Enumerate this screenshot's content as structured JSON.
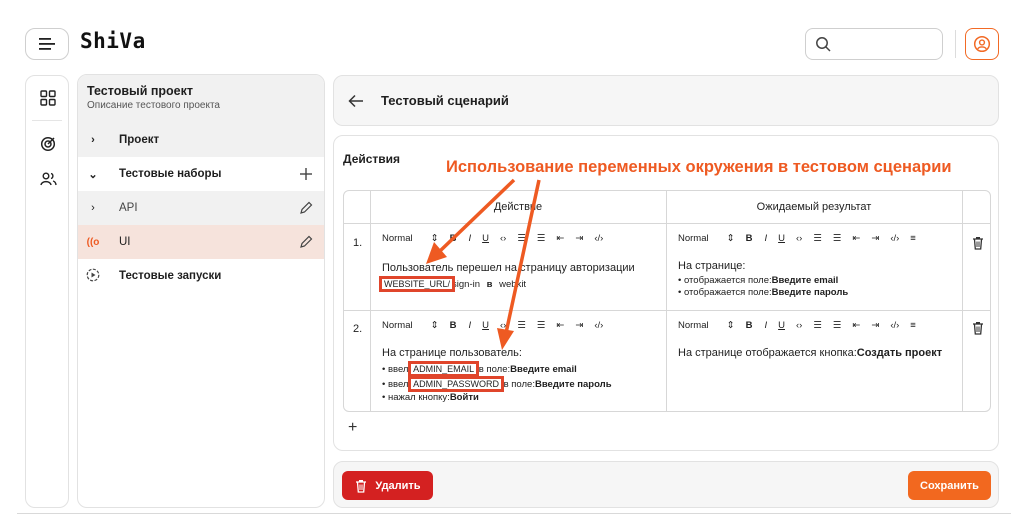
{
  "app": {
    "logo": "ShiVa"
  },
  "header": {
    "search_placeholder": ""
  },
  "project": {
    "title": "Тестовый проект",
    "description": "Описание тестового проекта"
  },
  "tree": {
    "items": [
      {
        "label": "Проект",
        "chevron": "›"
      },
      {
        "label": "Тестовые наборы",
        "chevron": "⌄"
      },
      {
        "label": "API",
        "chevron": "›"
      },
      {
        "label": "UI",
        "chevron": "((o"
      },
      {
        "label": "Тестовые запуски"
      }
    ]
  },
  "scenario": {
    "title": "Тестовый сценарий"
  },
  "actions": {
    "title": "Действия",
    "annotation": "Использование переменных окружения в тестовом сценарии",
    "columns": {
      "action": "Действие",
      "expected": "Ожидаемый результат"
    },
    "toolbar": {
      "format": "Normal",
      "bold": "B",
      "italic": "I",
      "underline": "U",
      "code": "‹›",
      "ol": "☰",
      "ul": "☰",
      "outdent": "⇤",
      "indent": "⇥",
      "codeblock": "‹/›",
      "strike": "≡"
    },
    "steps": [
      {
        "number": "1.",
        "action_line1": "Пользователь перешел на страницу авторизации",
        "action_var": "WEBSITE_URL/",
        "action_rest": "sign-in",
        "action_in": "в",
        "action_tail": "webkit",
        "expected_title": "На странице:",
        "expected_b1_prefix": "• отображается поле:",
        "expected_b1_bold": "Введите email",
        "expected_b2_prefix": "• отображается поле:",
        "expected_b2_bold": "Введите пароль"
      },
      {
        "number": "2.",
        "action_line1": "На странице пользователь:",
        "b1_prefix": "• ввел",
        "b1_var": "ADMIN_EMAIL",
        "b1_mid": "в поле:",
        "b1_bold": "Введите email",
        "b2_prefix": "• ввел",
        "b2_var": "ADMIN_PASSWORD",
        "b2_mid": "в поле:",
        "b2_bold": "Введите пароль",
        "b3_prefix": "• нажал кнопку:",
        "b3_bold": "Войти",
        "expected_prefix": "На странице отображается кнопка:",
        "expected_bold": "Создать проект"
      }
    ],
    "add": "+"
  },
  "footer": {
    "delete_label": "Удалить",
    "save_label": "Сохранить"
  },
  "colors": {
    "accent": "#f2681f",
    "danger": "#d42121",
    "annotation": "#ee5a22",
    "selected_row": "#f6e3dc"
  }
}
